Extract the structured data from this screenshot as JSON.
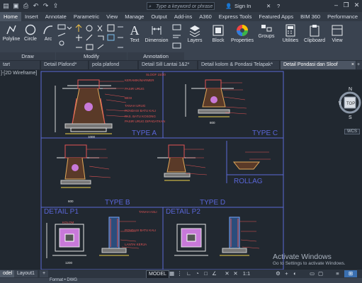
{
  "titlebar": {
    "search_placeholder": "Type a keyword or phrase",
    "sign_in": "Sign In",
    "quick_access_icons": [
      "save-icon",
      "save-as-icon",
      "plot-icon",
      "undo-icon",
      "redo-icon",
      "share-icon"
    ]
  },
  "ribbon_tabs": [
    "Home",
    "Insert",
    "Annotate",
    "Parametric",
    "View",
    "Manage",
    "Output",
    "Add-ins",
    "A360",
    "Express Tools",
    "Featured Apps",
    "BIM 360",
    "Performance"
  ],
  "ribbon": {
    "draw_tools": [
      "Polyline",
      "Circle",
      "Arc"
    ],
    "text_label": "Text",
    "dimension_label": "Dimension",
    "layers_label": "Layers",
    "block_label": "Block",
    "properties_label": "Properties",
    "groups_label": "Groups",
    "utilities_label": "Utilities",
    "clipboard_label": "Clipboard",
    "view_label": "View",
    "panels": [
      "Draw",
      "Modify",
      "Annotation"
    ]
  },
  "doc_tabs": [
    "tart",
    "Detail Plafond*",
    "pola plafond",
    "Detail Sill Lantai 1&2*",
    "Detail kolom & Pondasi Telapak*",
    "Detail Pondasi dan Sloof"
  ],
  "canvas": {
    "view_label": "]-[2D Wireframe]",
    "viewcube": {
      "top": "TOP",
      "n": "N",
      "s": "S",
      "w": "W"
    },
    "wcs": "WCS",
    "drawing_titles": [
      "TYPE A",
      "TYPE C",
      "TYPE B",
      "TYPE D",
      "ROLLAG",
      "DETAIL P1",
      "DETAIL P2"
    ],
    "annotations": [
      "SLOOF 15/20",
      "KERAMIK/MARMER",
      "PASIR URUG",
      "BESI",
      "TANAH URUG",
      "PONDASI BATU KALI",
      "PAS. BATU KOSONG",
      "PASIR URUG DIPADATKAN",
      "TANAH ASLI",
      "KOLOM",
      "PONDASI BATU KALI",
      "LANTAI KERJA"
    ],
    "dimensions": [
      "600",
      "1000",
      "800",
      "1200"
    ],
    "watermark_title": "Activate Windows",
    "watermark_sub": "Go to Settings to activate Windows."
  },
  "statusbar": {
    "layout_tabs": [
      "odel",
      "Layout1"
    ],
    "model_button": "MODEL",
    "scale": "1:1"
  },
  "command_line": "Format • DWG"
}
